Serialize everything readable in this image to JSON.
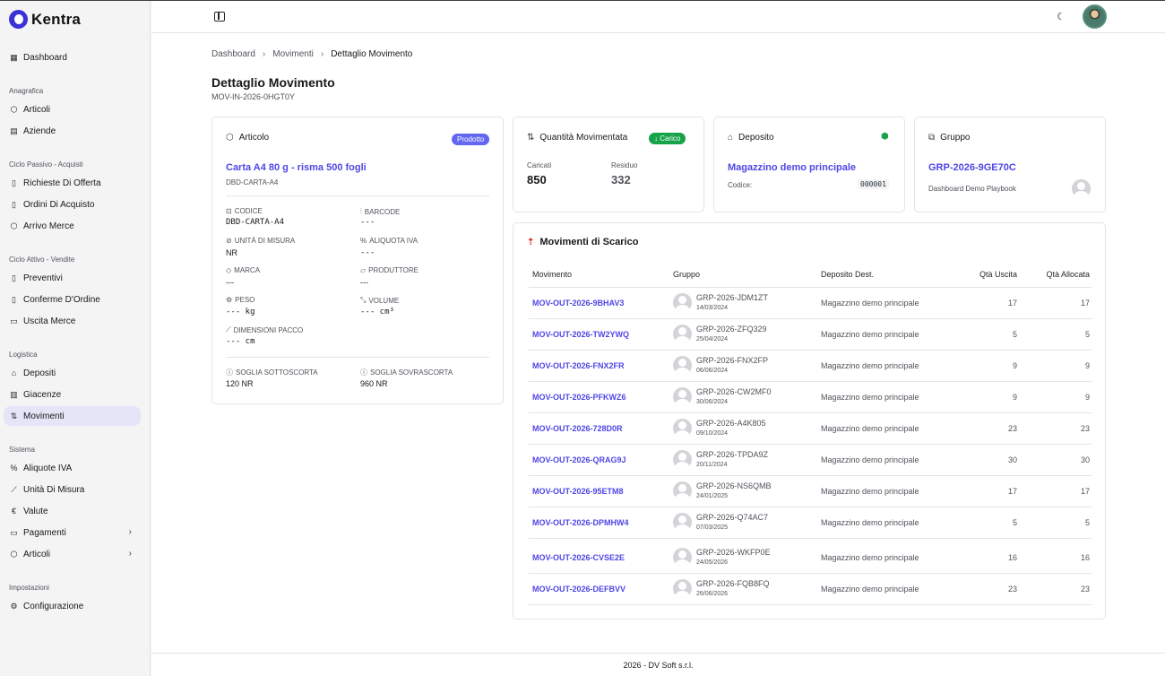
{
  "app": {
    "name": "Kentra"
  },
  "colors": {
    "accent": "#4f46e5",
    "badge_prodotto": "#6366f1",
    "badge_carico": "#16a34a",
    "deposit_icon": "#16a34a",
    "scarico_icon": "#dc2626"
  },
  "sidebar": {
    "dashboard": "Dashboard",
    "sections": {
      "anagrafica": "Anagrafica",
      "ciclo_passivo": "Ciclo Passivo - Acquisti",
      "ciclo_attivo": "Ciclo Attivo - Vendite",
      "logistica": "Logistica",
      "sistema": "Sistema",
      "impostazioni": "Impostazioni"
    },
    "items": {
      "articoli": "Articoli",
      "aziende": "Aziende",
      "richieste_offerta": "Richieste Di Offerta",
      "ordini_acquisto": "Ordini Di Acquisto",
      "arrivo_merce": "Arrivo Merce",
      "preventivi": "Preventivi",
      "conferme_ordine": "Conferme D'Ordine",
      "uscita_merce": "Uscita Merce",
      "depositi": "Depositi",
      "giacenze": "Giacenze",
      "movimenti": "Movimenti",
      "aliquote_iva": "Aliquote IVA",
      "unita_misura": "Unità Di Misura",
      "valute": "Valute",
      "pagamenti": "Pagamenti",
      "articoli_sistema": "Articoli",
      "configurazione": "Configurazione"
    }
  },
  "breadcrumb": [
    "Dashboard",
    "Movimenti",
    "Dettaglio Movimento"
  ],
  "page": {
    "title": "Dettaglio Movimento",
    "subtitle": "MOV-IN-2026-0HGT0Y"
  },
  "articolo": {
    "header": "Articolo",
    "badge": "Prodotto",
    "name": "Carta A4 80 g - risma 500 fogli",
    "code": "DBD-CARTA-A4",
    "fields": {
      "codice_label": "CODICE",
      "codice": "DBD-CARTA-A4",
      "barcode_label": "BARCODE",
      "barcode": "---",
      "um_label": "UNITÀ DI MISURA",
      "um": "NR",
      "iva_label": "ALIQUOTA IVA",
      "iva": "---",
      "marca_label": "MARCA",
      "marca": "---",
      "produttore_label": "PRODUTTORE",
      "produttore": "---",
      "peso_label": "PESO",
      "peso": "--- kg",
      "volume_label": "VOLUME",
      "volume": "--- cm³",
      "dimensioni_label": "DIMENSIONI PACCO",
      "dimensioni": "--- cm",
      "sottoscorta_label": "SOGLIA SOTTOSCORTA",
      "sottoscorta": "120 NR",
      "sovrascorta_label": "SOGLIA SOVRASCORTA",
      "sovrascorta": "960 NR"
    }
  },
  "quantita": {
    "header": "Quantità Movimentata",
    "badge": "Carico",
    "caricati_label": "Caricati",
    "caricati": "850",
    "residuo_label": "Residuo",
    "residuo": "332"
  },
  "deposito": {
    "header": "Deposito",
    "name": "Magazzino demo principale",
    "codice_label": "Codice:",
    "codice": "000001"
  },
  "gruppo": {
    "header": "Gruppo",
    "name": "GRP-2026-9GE70C",
    "subtitle": "Dashboard Demo Playbook"
  },
  "scarico": {
    "title": "Movimenti di Scarico",
    "columns": [
      "Movimento",
      "Gruppo",
      "Deposito Dest.",
      "Qtà Uscita",
      "Qtà Allocata"
    ],
    "rows": [
      {
        "movimento": "MOV-OUT-2026-9BHAV3",
        "gruppo": "GRP-2026-JDM1ZT",
        "data": "14/03/2024",
        "deposito": "Magazzino demo principale",
        "uscita": "17",
        "allocata": "17"
      },
      {
        "movimento": "MOV-OUT-2026-TW2YWQ",
        "gruppo": "GRP-2026-ZFQ329",
        "data": "25/04/2024",
        "deposito": "Magazzino demo principale",
        "uscita": "5",
        "allocata": "5"
      },
      {
        "movimento": "MOV-OUT-2026-FNX2FR",
        "gruppo": "GRP-2026-FNX2FP",
        "data": "06/06/2024",
        "deposito": "Magazzino demo principale",
        "uscita": "9",
        "allocata": "9"
      },
      {
        "movimento": "MOV-OUT-2026-PFKWZ6",
        "gruppo": "GRP-2026-CW2MF0",
        "data": "30/06/2024",
        "deposito": "Magazzino demo principale",
        "uscita": "9",
        "allocata": "9"
      },
      {
        "movimento": "MOV-OUT-2026-728D0R",
        "gruppo": "GRP-2026-A4K805",
        "data": "09/10/2024",
        "deposito": "Magazzino demo principale",
        "uscita": "23",
        "allocata": "23"
      },
      {
        "movimento": "MOV-OUT-2026-QRAG9J",
        "gruppo": "GRP-2026-TPDA9Z",
        "data": "20/11/2024",
        "deposito": "Magazzino demo principale",
        "uscita": "30",
        "allocata": "30"
      },
      {
        "movimento": "MOV-OUT-2026-95ETM8",
        "gruppo": "GRP-2026-NS6QMB",
        "data": "24/01/2025",
        "deposito": "Magazzino demo principale",
        "uscita": "17",
        "allocata": "17"
      },
      {
        "movimento": "MOV-OUT-2026-DPMHW4",
        "gruppo": "GRP-2026-Q74AC7",
        "data": "07/03/2025",
        "deposito": "Magazzino demo principale",
        "uscita": "5",
        "allocata": "5"
      },
      {
        "movimento": "MOV-OUT-2026-CVSE2E",
        "gruppo": "GRP-2026-WKFP0E",
        "data": "24/05/2026",
        "deposito": "Magazzino demo principale",
        "uscita": "16",
        "allocata": "16"
      },
      {
        "movimento": "MOV-OUT-2026-DEFBVV",
        "gruppo": "GRP-2026-FQB8FQ",
        "data": "26/06/2026",
        "deposito": "Magazzino demo principale",
        "uscita": "23",
        "allocata": "23"
      }
    ]
  },
  "footer": "2026 - DV Soft s.r.l."
}
